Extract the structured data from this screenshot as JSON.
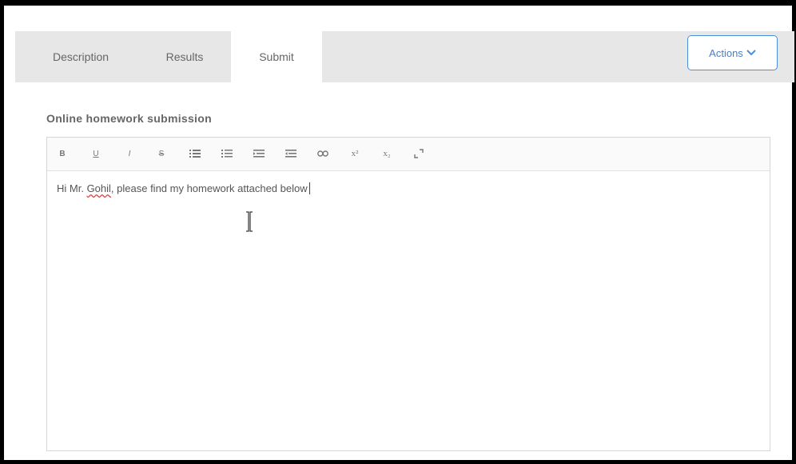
{
  "tabs": [
    {
      "label": "Description"
    },
    {
      "label": "Results"
    },
    {
      "label": "Submit"
    }
  ],
  "active_tab": "Submit",
  "actions": {
    "label": "Actions",
    "icon": "chevron-down-icon",
    "color": "#4a90d9"
  },
  "section_title": "Online homework submission",
  "toolbar": {
    "bold": "B",
    "underline": "U",
    "italic": "I",
    "strikethrough": "S",
    "superscript": "x²",
    "subscript": "x₂",
    "icons": [
      "bold-icon",
      "underline-icon",
      "italic-icon",
      "strikethrough-icon",
      "bullet-list-icon",
      "numbered-list-icon",
      "indent-icon",
      "outdent-icon",
      "link-icon",
      "superscript-icon",
      "subscript-icon",
      "fullscreen-icon"
    ]
  },
  "editor": {
    "text_before": "Hi Mr. ",
    "misspelled_word": "Gohil",
    "text_after": ", please find my homework attached below"
  }
}
